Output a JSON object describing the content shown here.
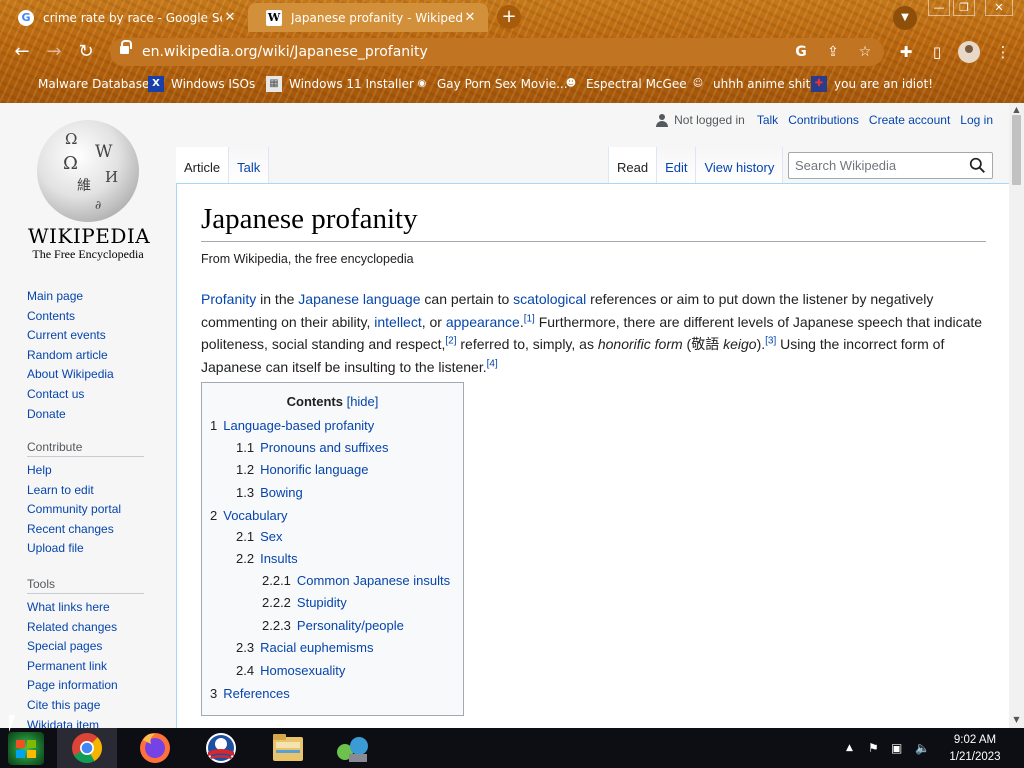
{
  "browser": {
    "tabs": [
      {
        "title": "crime rate by race - Google Searc",
        "favicon": "google-icon",
        "close": "✕"
      },
      {
        "title": "Japanese profanity - Wikipedia",
        "favicon": "wikipedia-icon",
        "close": "✕"
      }
    ],
    "new_tab": "+",
    "window_buttons": {
      "minimize": "—",
      "restore": "❐",
      "close": "✕"
    },
    "url": "en.wikipedia.org/wiki/Japanese_profanity",
    "bookmarks": [
      "Malware Database",
      "Windows ISOs",
      "Windows 11 Installer",
      "Gay Porn Sex Movie...",
      "Espectral McGee",
      "uhhh anime shit",
      "you are an idiot!"
    ]
  },
  "wiki": {
    "logo": {
      "wordmark": "Wikipedia",
      "tagline": "The Free Encyclopedia"
    },
    "personal": {
      "not_logged_in": "Not logged in",
      "talk": "Talk",
      "contributions": "Contributions",
      "create_account": "Create account",
      "log_in": "Log in"
    },
    "nav": [
      "Main page",
      "Contents",
      "Current events",
      "Random article",
      "About Wikipedia",
      "Contact us",
      "Donate"
    ],
    "contribute": {
      "heading": "Contribute",
      "items": [
        "Help",
        "Learn to edit",
        "Community portal",
        "Recent changes",
        "Upload file"
      ]
    },
    "tools": {
      "heading": "Tools",
      "items": [
        "What links here",
        "Related changes",
        "Special pages",
        "Permanent link",
        "Page information",
        "Cite this page",
        "Wikidata item"
      ]
    },
    "tabs_left": [
      "Article",
      "Talk"
    ],
    "tabs_right": [
      "Read",
      "Edit",
      "View history"
    ],
    "search_placeholder": "Search Wikipedia",
    "title": "Japanese profanity",
    "from": "From Wikipedia, the free encyclopedia",
    "lead": {
      "profanity": "Profanity",
      "t1": " in the ",
      "japanese_language": "Japanese language",
      "t2": " can pertain to ",
      "scatological": "scatological",
      "t3": " references or aim to put down the listener by negatively commenting on their ability, ",
      "intellect": "intellect",
      "t4": ", or ",
      "appearance": "appearance",
      "t5": ".",
      "ref1": "[1]",
      "t6": " Furthermore, there are different levels of Japanese speech that indicate politeness, social standing and respect,",
      "ref2": "[2]",
      "t7": " referred to, simply, as ",
      "honorific_form": "honorific form",
      "t8": " (敬語 ",
      "keigo": "keigo",
      "t9": ").",
      "ref3": "[3]",
      "t10": " Using the incorrect form of Japanese can itself be insulting to the listener.",
      "ref4": "[4]"
    },
    "toc": {
      "title": "Contents",
      "hide": "[hide]",
      "items": [
        {
          "num": "1",
          "text": "Language-based profanity",
          "level": 1
        },
        {
          "num": "1.1",
          "text": "Pronouns and suffixes",
          "level": 2
        },
        {
          "num": "1.2",
          "text": "Honorific language",
          "level": 2
        },
        {
          "num": "1.3",
          "text": "Bowing",
          "level": 2
        },
        {
          "num": "2",
          "text": "Vocabulary",
          "level": 1
        },
        {
          "num": "2.1",
          "text": "Sex",
          "level": 2
        },
        {
          "num": "2.2",
          "text": "Insults",
          "level": 2
        },
        {
          "num": "2.2.1",
          "text": "Common Japanese insults",
          "level": 3
        },
        {
          "num": "2.2.2",
          "text": "Stupidity",
          "level": 3
        },
        {
          "num": "2.2.3",
          "text": "Personality/people",
          "level": 3
        },
        {
          "num": "2.3",
          "text": "Racial euphemisms",
          "level": 2
        },
        {
          "num": "2.4",
          "text": "Homosexuality",
          "level": 2
        },
        {
          "num": "3",
          "text": "References",
          "level": 1
        }
      ]
    }
  },
  "taskbar": {
    "apps": [
      "start-button",
      "chrome-icon",
      "firefox-icon",
      "obama-icon",
      "file-explorer-icon",
      "network-app-icon"
    ],
    "time": "9:02 AM",
    "date": "1/21/2023"
  },
  "colors": {
    "link": "#0645ad",
    "chrome_frame": "#b8650e",
    "taskbar": "#0d0d14"
  }
}
